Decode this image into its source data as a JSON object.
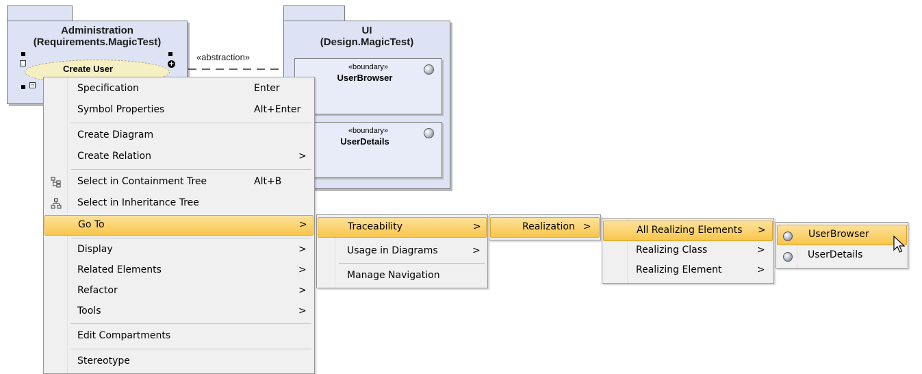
{
  "diagram": {
    "packages": [
      {
        "name": "Administration",
        "qualifier": "(Requirements.MagicTest)"
      },
      {
        "name": "UI",
        "qualifier": "(Design.MagicTest)"
      }
    ],
    "use_case": "Create User",
    "dependency_label": "«abstraction»",
    "classes": [
      {
        "stereotype": "«boundary»",
        "name": "UserBrowser"
      },
      {
        "stereotype": "«boundary»",
        "name": "UserDetails"
      }
    ]
  },
  "context_menu": {
    "items": [
      {
        "label": "Specification",
        "shortcut": "Enter"
      },
      {
        "label": "Symbol Properties",
        "shortcut": "Alt+Enter"
      },
      {
        "label": "Create Diagram"
      },
      {
        "label": "Create Relation",
        "submenu_arrow": ">"
      },
      {
        "label": "Select in Containment Tree",
        "shortcut": "Alt+B",
        "icon": "containment-tree-icon"
      },
      {
        "label": "Select in Inheritance Tree",
        "icon": "inheritance-tree-icon"
      },
      {
        "label": "Go To",
        "submenu_arrow": ">",
        "highlighted": true
      },
      {
        "label": "Display",
        "submenu_arrow": ">"
      },
      {
        "label": "Related Elements",
        "submenu_arrow": ">"
      },
      {
        "label": "Refactor",
        "submenu_arrow": ">"
      },
      {
        "label": "Tools",
        "submenu_arrow": ">"
      },
      {
        "label": "Edit Compartments"
      },
      {
        "label": "Stereotype"
      }
    ]
  },
  "goto_menu": {
    "items": [
      {
        "label": "Traceability",
        "submenu_arrow": ">",
        "highlighted": true
      },
      {
        "label": "Usage in Diagrams",
        "submenu_arrow": ">"
      },
      {
        "label": "Manage Navigation"
      }
    ]
  },
  "traceability_menu": {
    "items": [
      {
        "label": "Realization",
        "submenu_arrow": ">",
        "highlighted": true
      }
    ]
  },
  "realization_menu": {
    "items": [
      {
        "label": "All Realizing Elements",
        "submenu_arrow": ">",
        "highlighted": true
      },
      {
        "label": "Realizing Class",
        "submenu_arrow": ">"
      },
      {
        "label": "Realizing Element",
        "submenu_arrow": ">"
      }
    ]
  },
  "elements_menu": {
    "items": [
      {
        "label": "UserBrowser",
        "icon": "boundary-class-icon",
        "highlighted": true
      },
      {
        "label": "UserDetails",
        "icon": "boundary-class-icon"
      }
    ]
  },
  "colors": {
    "package_fill": "#dde3f5",
    "highlight": "#f8c64c",
    "menu_background": "#f0f0f0"
  }
}
